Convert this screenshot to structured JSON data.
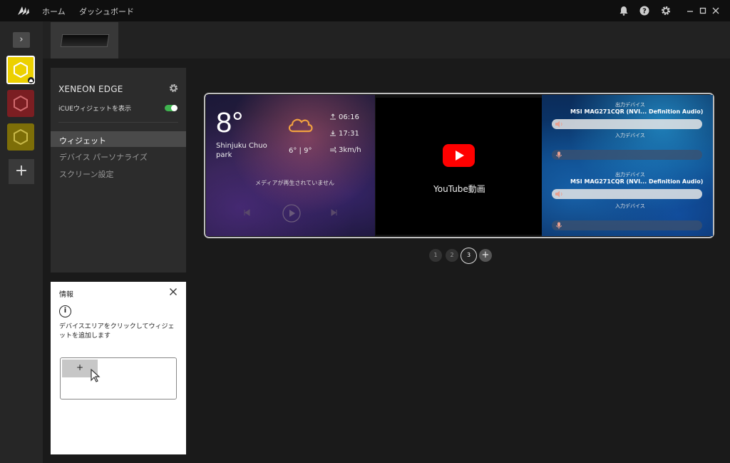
{
  "titlebar": {
    "nav": [
      "ホーム",
      "ダッシュボード"
    ]
  },
  "icons": {
    "logo": "corsair-sails-icon",
    "notifications": "bell-icon",
    "help": "help-icon",
    "settings": "gear-icon",
    "minimize": "minimize-icon",
    "maximize": "maximize-icon",
    "close": "close-icon"
  },
  "rail": {
    "toggle": "›",
    "add": "+"
  },
  "device_panel": {
    "name": "XENEON EDGE",
    "toggle_label": "iCUEウィジェットを表示",
    "toggle_on": true,
    "menu": [
      "ウィジェット",
      "デバイス パーソナライズ",
      "スクリーン設定"
    ],
    "selected_menu": "ウィジェット"
  },
  "info": {
    "title": "情報",
    "icon": "i",
    "text": "デバイスエリアをクリックしてウィジェットを追加します",
    "demo_button": "+"
  },
  "weather": {
    "temp": "8°",
    "location": "Shinjuku Chuo park",
    "range": "6° | 9°",
    "sunrise": "06:16",
    "sunset": "17:31",
    "wind": "3km/h"
  },
  "media": {
    "status": "メディアが再生されていません"
  },
  "youtube": {
    "label": "YouTube動画"
  },
  "audio": {
    "output_label": "出力デバイス",
    "input_label": "入力デバイス",
    "device_a": "MSI MAG271CQR (NVI... Definition Audio)",
    "device_b": "MSI MAG271CQR (NVI... Definition Audio)"
  },
  "pager": {
    "pages": [
      "1",
      "2",
      "3"
    ],
    "current": "3",
    "add": "+"
  },
  "colors": {
    "accent_green": "#3fb34f",
    "device_yellow": "#ecd000",
    "device_red": "#7b1e22",
    "device_olive": "#7d6e08",
    "youtube_red": "#ff0000",
    "cloud_orange": "#f0a040"
  }
}
